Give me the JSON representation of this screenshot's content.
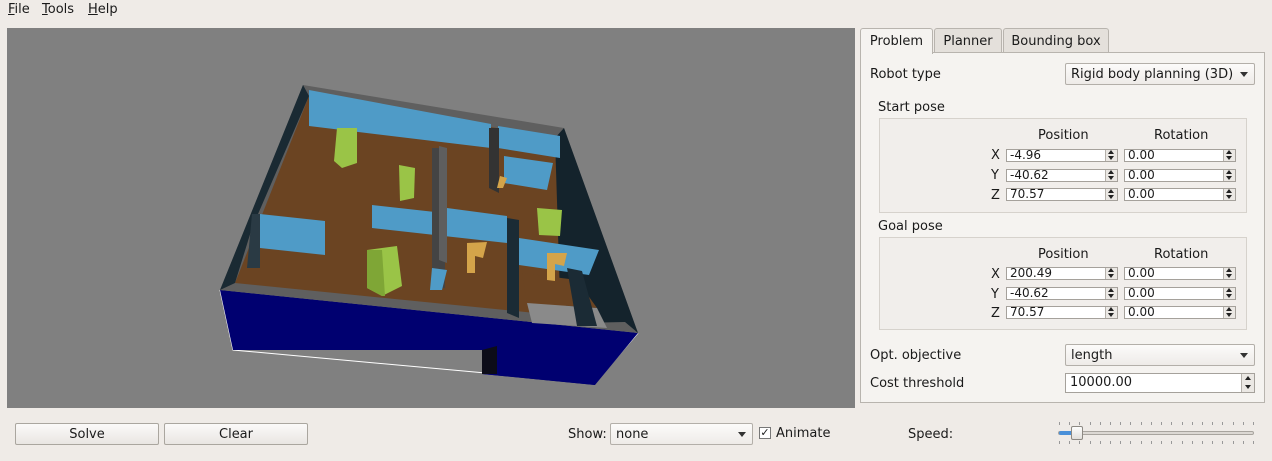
{
  "menu": {
    "file": "File",
    "tools": "Tools",
    "help": "Help"
  },
  "tabs": [
    "Problem",
    "Planner",
    "Bounding box"
  ],
  "problem": {
    "robot_type_label": "Robot type",
    "robot_type_value": "Rigid body planning (3D)",
    "start_pose": {
      "title": "Start pose",
      "position_header": "Position",
      "rotation_header": "Rotation",
      "rows": [
        {
          "axis": "X",
          "position": "-4.96",
          "rotation": "0.00"
        },
        {
          "axis": "Y",
          "position": "-40.62",
          "rotation": "0.00"
        },
        {
          "axis": "Z",
          "position": "70.57",
          "rotation": "0.00"
        }
      ]
    },
    "goal_pose": {
      "title": "Goal pose",
      "position_header": "Position",
      "rotation_header": "Rotation",
      "rows": [
        {
          "axis": "X",
          "position": "200.49",
          "rotation": "0.00"
        },
        {
          "axis": "Y",
          "position": "-40.62",
          "rotation": "0.00"
        },
        {
          "axis": "Z",
          "position": "70.57",
          "rotation": "0.00"
        }
      ]
    },
    "opt_objective_label": "Opt. objective",
    "opt_objective_value": "length",
    "cost_threshold_label": "Cost threshold",
    "cost_threshold_value": "10000.00"
  },
  "bottom": {
    "solve": "Solve",
    "clear": "Clear",
    "show_label": "Show:",
    "show_value": "none",
    "animate_label": "Animate",
    "animate_checked": true,
    "speed_label": "Speed:",
    "speed_value": 0.08
  },
  "colors": {
    "viewport_bg": "#808080",
    "floor": "#6b4422",
    "wall_blue": "#4f9bc7",
    "base_navy": "#000070",
    "obstacle_green": "#9ac447",
    "obstacle_tan": "#d4a44a"
  }
}
